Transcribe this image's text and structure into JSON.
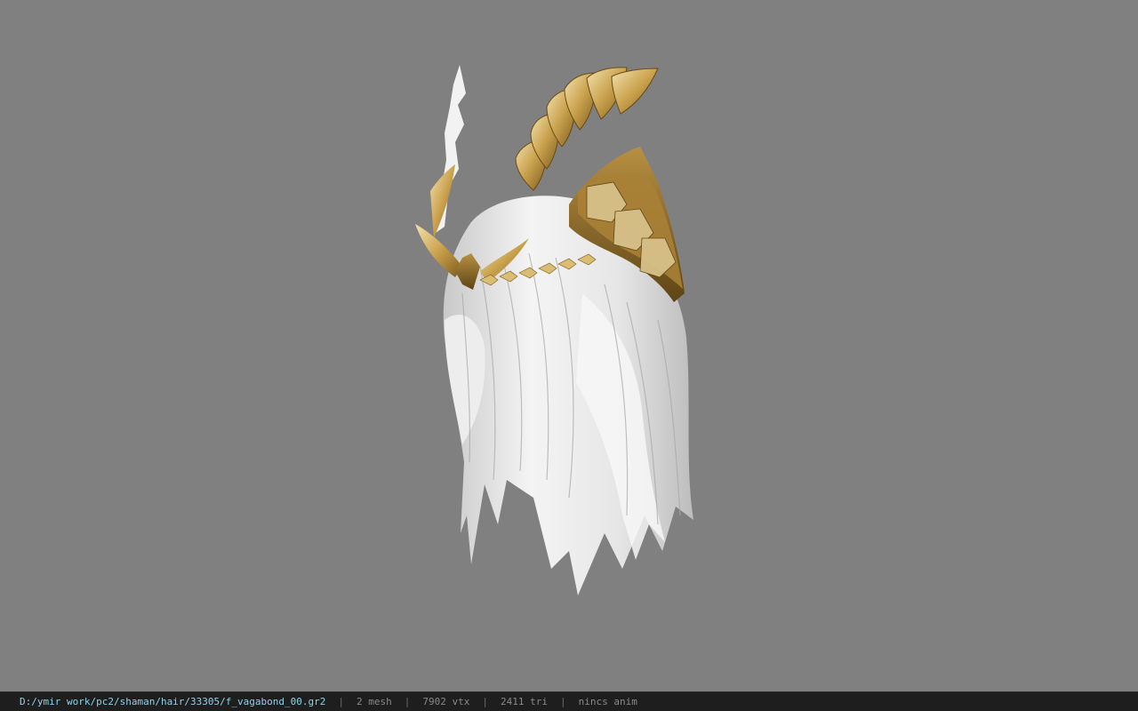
{
  "viewport": {
    "background": "#808080",
    "model_description": "white hair with golden winged headpiece"
  },
  "statusbar": {
    "file_path": "D:/ymir work/pc2/shaman/hair/33305/f_vagabond_00.gr2",
    "separator": "|",
    "mesh_count": "2 mesh",
    "vertex_count": "7902 vtx",
    "triangle_count": "2411 tri",
    "anim_info": "nincs anim",
    "path_color": "#8fd3ea",
    "text_color": "#8a8a8a",
    "background": "#1e1e1e"
  }
}
